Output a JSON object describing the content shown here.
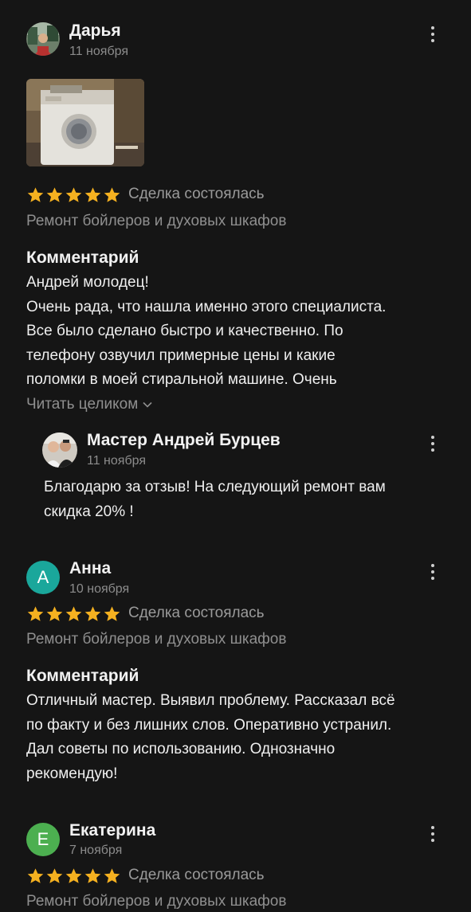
{
  "colors": {
    "background": "#151515",
    "star": "#f5b120",
    "avatar_anna": "#1aa79b",
    "avatar_ekaterina": "#4caf50"
  },
  "reviews": [
    {
      "author": "Дарья",
      "date": "11 ноября",
      "avatar_type": "photo",
      "has_photo": true,
      "rating": 5,
      "deal_status": "Сделка состоялась",
      "category": "Ремонт бойлеров и духовых шкафов",
      "comment_title": "Комментарий",
      "comment_lines": [
        "Андрей молодец!",
        "Очень рада, что нашла именно этого специалиста.",
        "Все было сделано быстро и качественно. По",
        "телефону озвучил примерные цены и какие",
        "поломки в моей стиральной машине. Очень"
      ],
      "read_more": "Читать целиком",
      "reply": {
        "author": "Мастер Андрей Бурцев",
        "date": "11 ноября",
        "lines": [
          "Благодарю за отзыв! На следующий ремонт вам",
          "скидка 20% !"
        ]
      }
    },
    {
      "author": "Анна",
      "avatar_letter": "А",
      "date": "10 ноября",
      "rating": 5,
      "deal_status": "Сделка состоялась",
      "category": "Ремонт бойлеров и духовых шкафов",
      "comment_title": "Комментарий",
      "comment_lines": [
        "Отличный мастер. Выявил проблему. Рассказал всё",
        "по факту и без лишних слов. Оперативно устранил.",
        "Дал советы по использованию. Однозначно",
        "рекомендую!"
      ]
    },
    {
      "author": "Екатерина",
      "avatar_letter": "Е",
      "date": "7 ноября",
      "rating": 5,
      "deal_status": "Сделка состоялась",
      "category": "Ремонт бойлеров и духовых шкафов"
    }
  ]
}
